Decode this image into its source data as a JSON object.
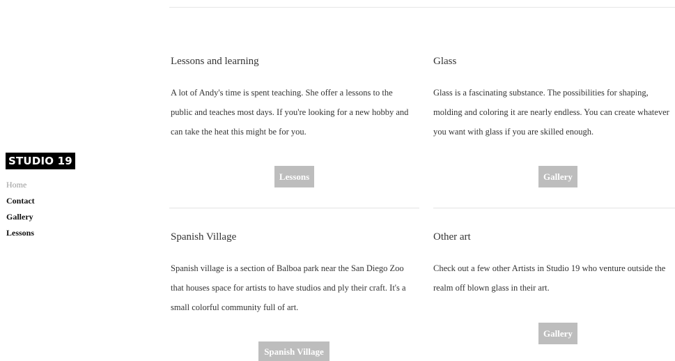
{
  "brand": {
    "logo": "STUDIO 19"
  },
  "nav": {
    "items": [
      {
        "label": "Home",
        "active": true
      },
      {
        "label": "Contact",
        "active": false
      },
      {
        "label": "Gallery",
        "active": false
      },
      {
        "label": "Lessons",
        "active": false
      }
    ]
  },
  "sections": [
    {
      "title": "Lessons and learning",
      "body": "A lot of Andy's time is spent teaching. She offer a lessons to the public and teaches most days. If you're looking for a new hobby and can take the heat this might be for you.",
      "button": "Lessons"
    },
    {
      "title": "Glass",
      "body": "Glass is a fascinating substance. The possibilities for shaping, molding and coloring it are nearly endless. You can create whatever you want with glass if you are skilled enough.",
      "button": "Gallery"
    },
    {
      "title": "Spanish Village",
      "body": "Spanish village is a section of Balboa park near the San Diego Zoo that houses space for artists to have studios and ply their craft. It's a small colorful community full of art.",
      "button": "Spanish Village"
    },
    {
      "title": "Other art",
      "body": "Check out a few other Artists in Studio 19 who venture outside the realm off blown glass in their art.",
      "button": "Gallery"
    }
  ],
  "colors": {
    "button_bg": "#bdbdbd",
    "button_text": "#ffffff",
    "logo_bg": "#000000",
    "nav_active": "#9a9a9a"
  }
}
